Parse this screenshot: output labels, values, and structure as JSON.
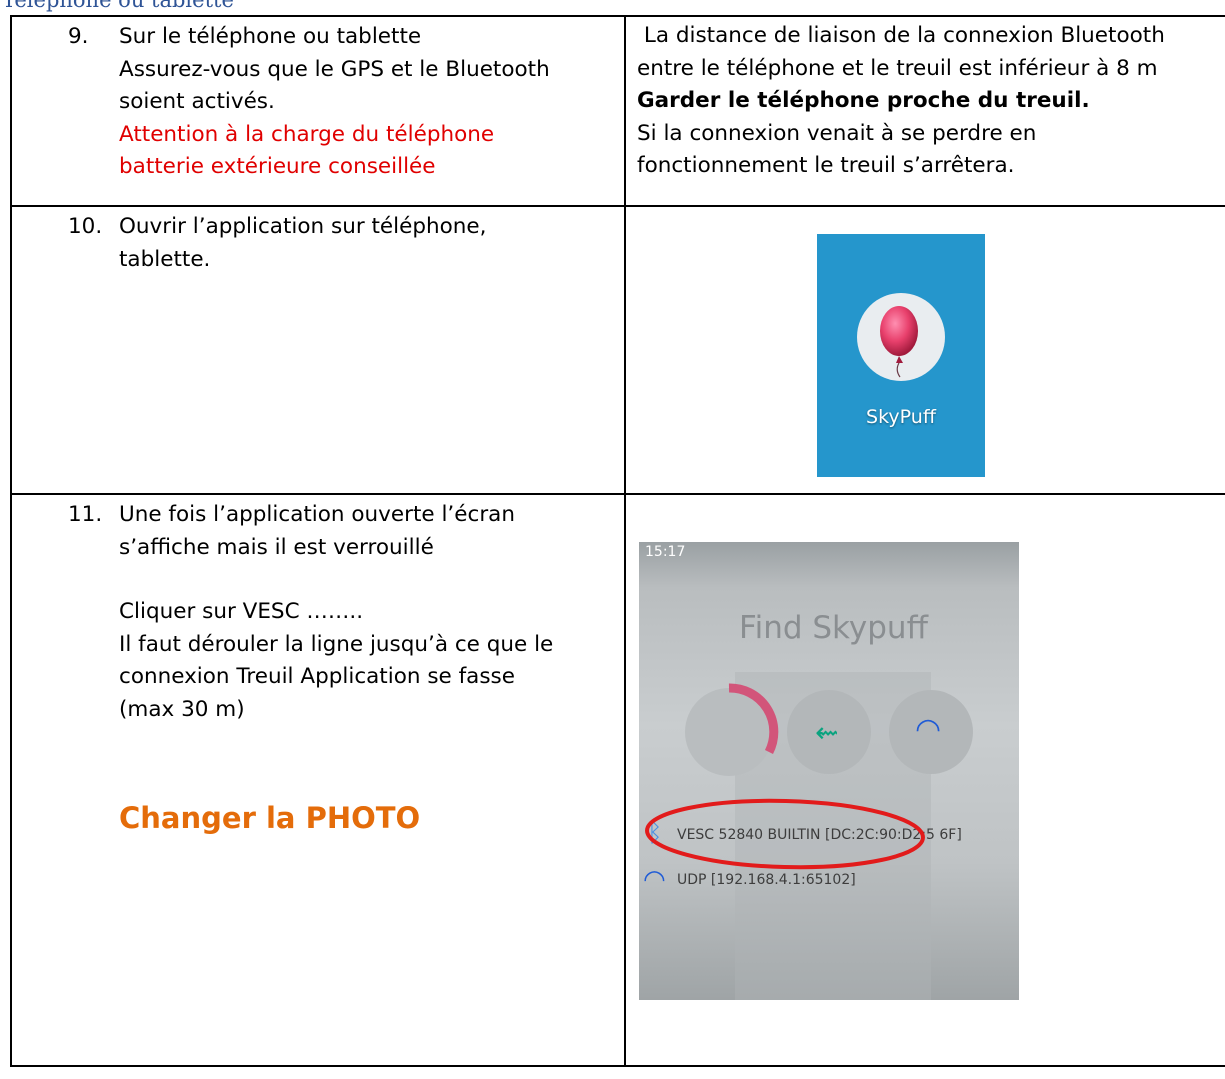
{
  "page": {
    "heading": "Téléphone ou tablette"
  },
  "rows": [
    {
      "num": "9.",
      "lines": [
        "Sur le téléphone ou tablette",
        "Assurez-vous que le GPS et le Bluetooth",
        "soient activés."
      ],
      "warning": [
        "Attention à la charge du téléphone",
        "batterie extérieure conseillée"
      ],
      "right": {
        "line1": " La distance de liaison de la connexion Bluetooth",
        "line2": "entre le téléphone et le treuil est inférieur à 8 m",
        "bold": "Garder le téléphone proche du treuil.",
        "line4": "Si la connexion venait à se perdre en",
        "line5": "fonctionnement le treuil s’arrêtera."
      }
    },
    {
      "num": "10.",
      "lines": [
        "Ouvrir l’application sur téléphone,",
        "tablette."
      ],
      "app_icon": {
        "label": "SkyPuff"
      }
    },
    {
      "num": "11.",
      "lines": [
        "Une fois l’application ouverte l’écran",
        "s’affiche mais il est verrouillé"
      ],
      "lines2": [
        "Cliquer sur VESC ……..",
        "Il faut dérouler la ligne jusqu’à ce que le",
        "connexion Treuil Application se fasse",
        "(max 30 m)"
      ],
      "note": "Changer la PHOTO",
      "photo": {
        "status_time": "15:17",
        "title": "Find Skypuff",
        "device1": "VESC 52840 BUILTIN [DC:2C:90:D2:5 6F]",
        "device2": "UDP [192.168.4.1:65102]"
      }
    }
  ],
  "colors": {
    "heading": "#2f5496",
    "warning": "#e00000",
    "note": "#e46c0a",
    "app_bg": "#2596cc"
  }
}
